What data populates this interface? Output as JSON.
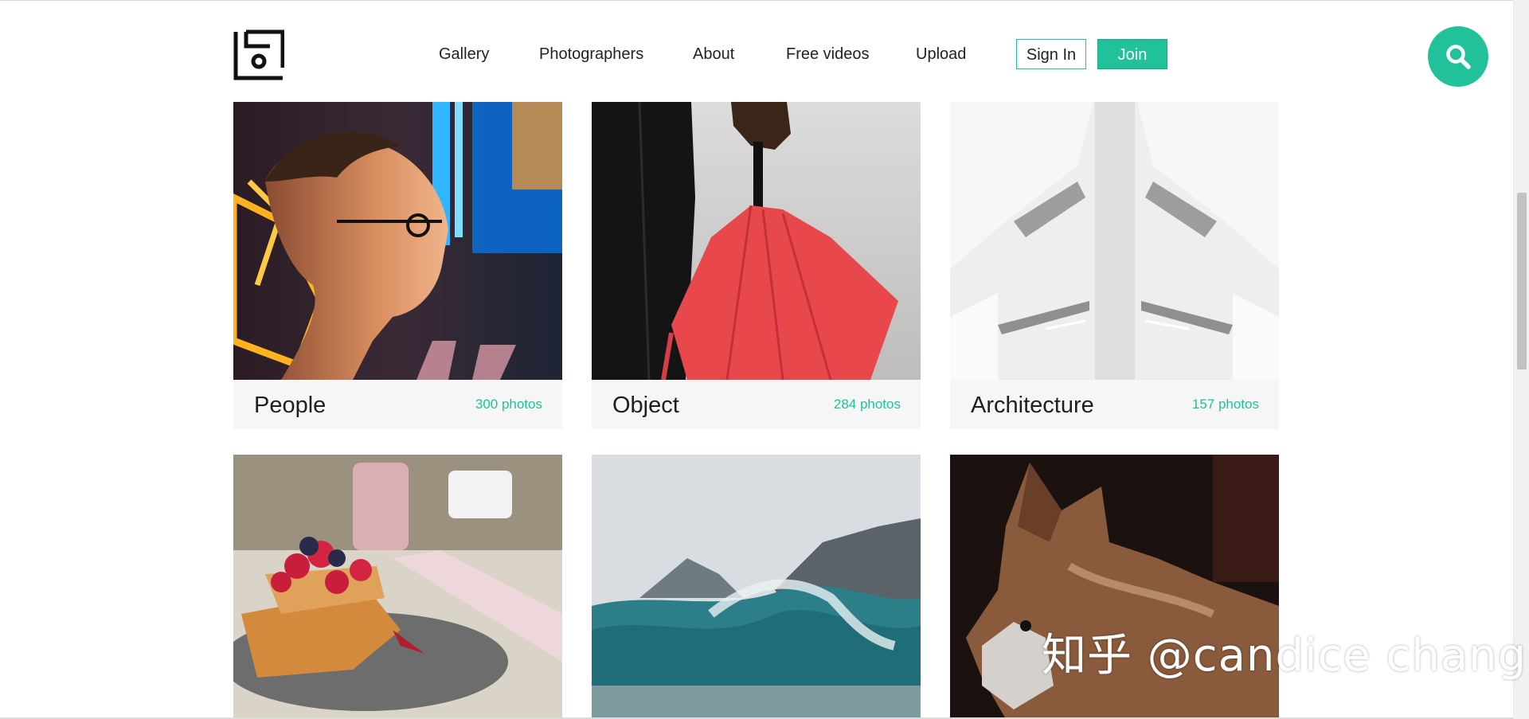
{
  "header": {
    "nav": [
      {
        "label": "Gallery",
        "name": "nav-gallery"
      },
      {
        "label": "Photographers",
        "name": "nav-photographers"
      },
      {
        "label": "About",
        "name": "nav-about"
      },
      {
        "label": "Free videos",
        "name": "nav-free-videos"
      },
      {
        "label": "Upload",
        "name": "nav-upload"
      }
    ],
    "signin_label": "Sign In",
    "join_label": "Join"
  },
  "categories": [
    {
      "title": "People",
      "count": "300 photos"
    },
    {
      "title": "Object",
      "count": "284 photos"
    },
    {
      "title": "Architecture",
      "count": "157 photos"
    }
  ],
  "watermark": "知乎 @candice chang",
  "colors": {
    "accent": "#21c19b"
  },
  "icons": {
    "search": "search-icon",
    "logo": "site-logo-icon"
  }
}
